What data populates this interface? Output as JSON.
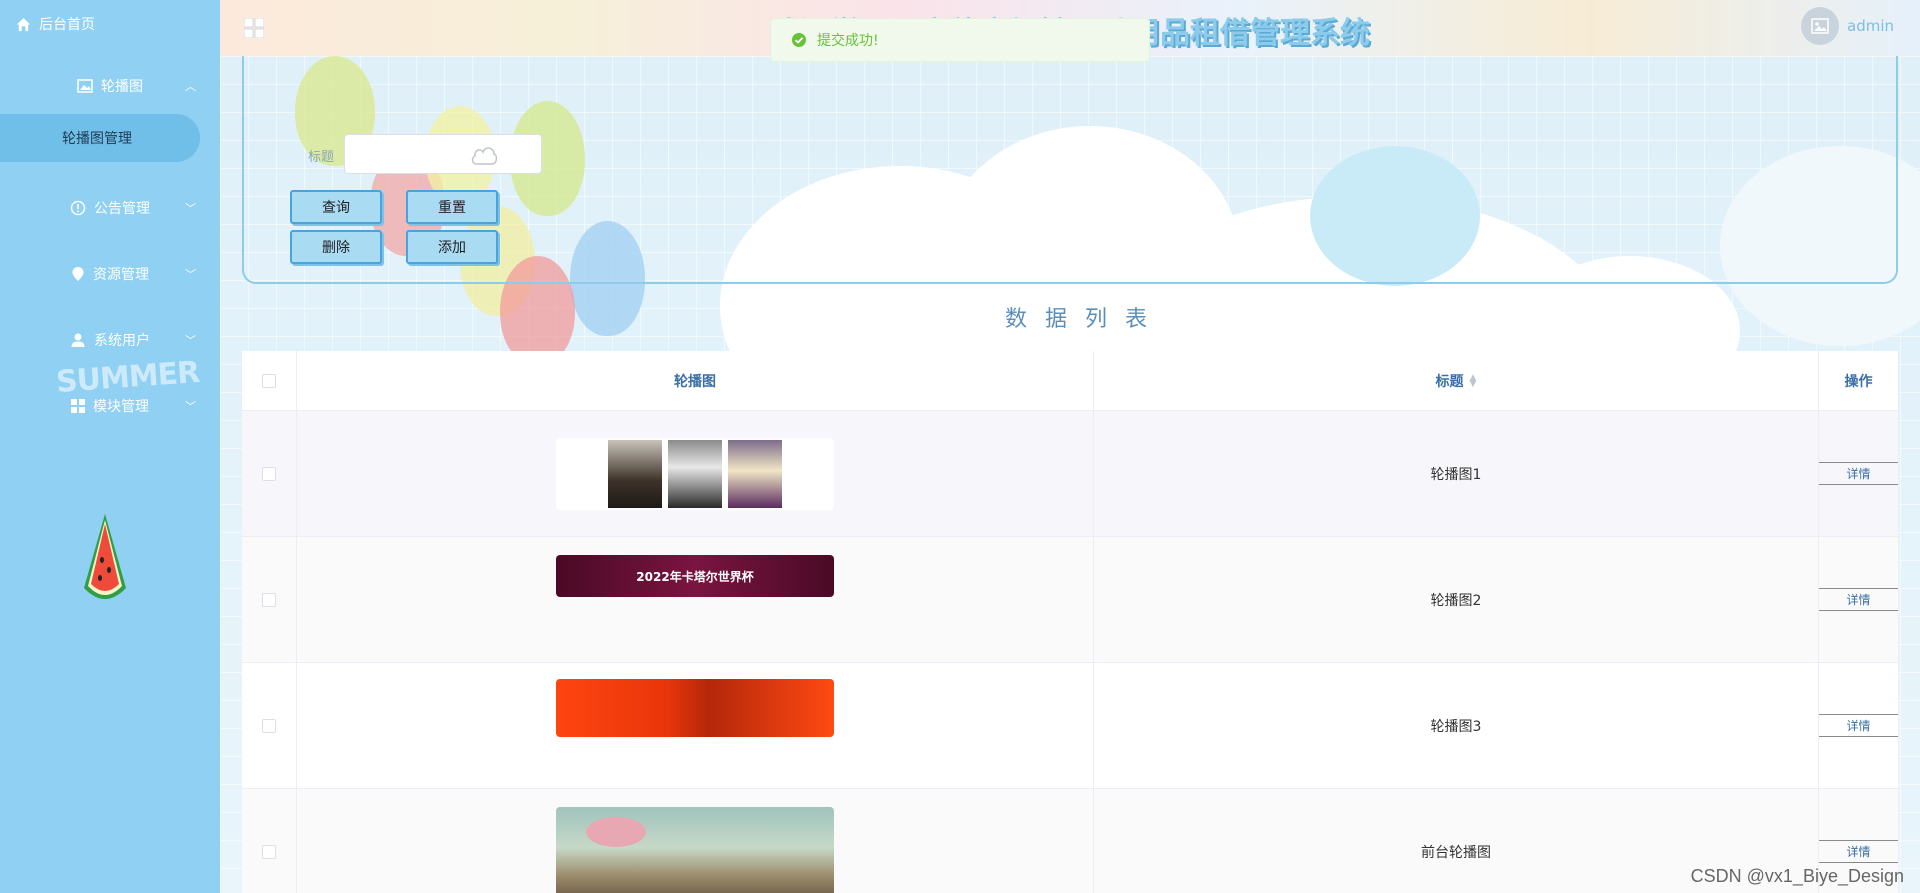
{
  "sidebar": {
    "home": "后台首页",
    "groups": [
      {
        "label": "轮播图"
      },
      {
        "label": "公告管理"
      },
      {
        "label": "资源管理"
      },
      {
        "label": "系统用户"
      },
      {
        "label": "模块管理"
      }
    ],
    "active_sub": "轮播图管理",
    "decor_text": "SUMMER"
  },
  "header": {
    "title": "武汉学区公寓体育场馆运动用品租借管理系统",
    "user": "admin"
  },
  "toast": {
    "message": "提交成功!",
    "color": "#67c23a"
  },
  "search": {
    "label": "标题",
    "value": "",
    "buttons": {
      "query": "查询",
      "reset": "重置",
      "delete": "删除",
      "add": "添加"
    }
  },
  "list_title": "数据列表",
  "table": {
    "headers": {
      "image": "轮播图",
      "title": "标题",
      "op": "操作"
    },
    "rows": [
      {
        "title": "轮播图1",
        "action": "详情"
      },
      {
        "title": "轮播图2",
        "action": "详情",
        "banner_text": "2022年卡塔尔世界杯"
      },
      {
        "title": "轮播图3",
        "action": "详情"
      },
      {
        "title": "前台轮播图",
        "action": "详情"
      }
    ]
  },
  "watermark": "CSDN @vx1_Biye_Design",
  "colors": {
    "sidebar": "#8fd0f3",
    "accent": "#3a6fa7",
    "button": "#a9dbf3"
  }
}
